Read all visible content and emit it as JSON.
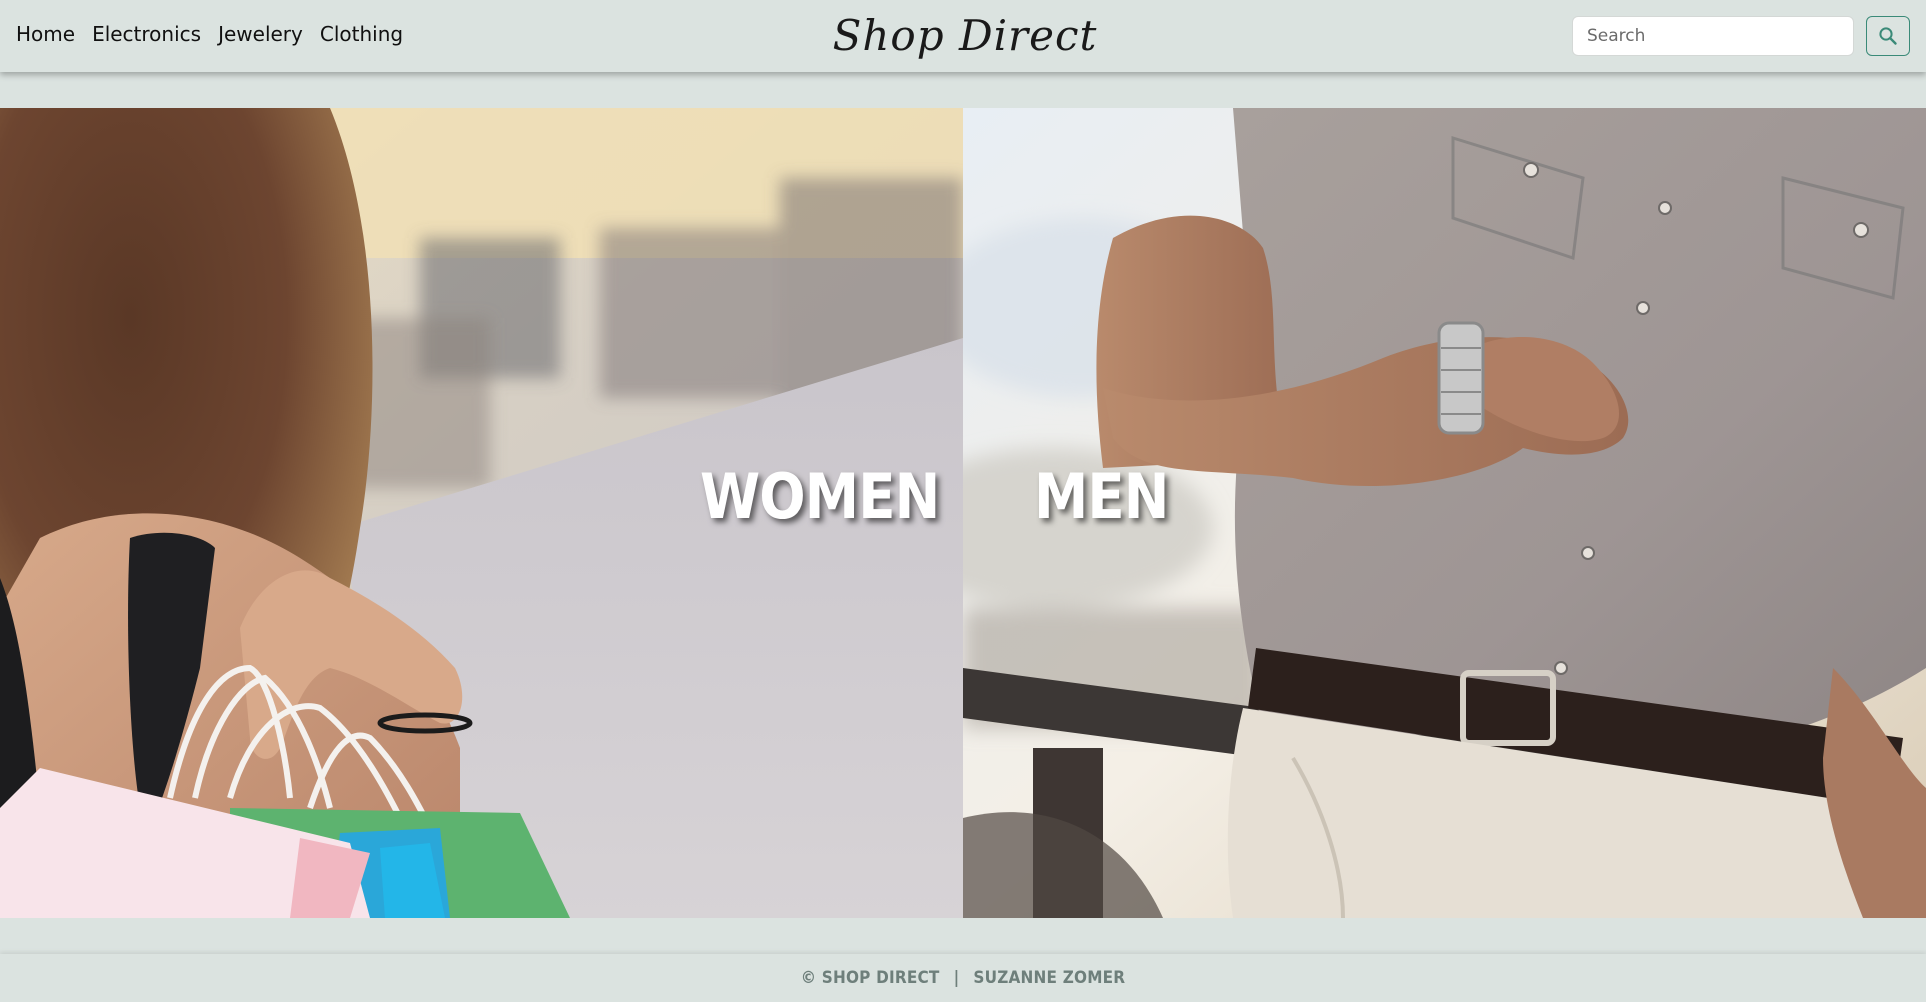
{
  "nav": {
    "links": [
      {
        "label": "Home"
      },
      {
        "label": "Electronics"
      },
      {
        "label": "Jewelery"
      },
      {
        "label": "Clothing"
      }
    ],
    "brand": "Shop Direct",
    "search": {
      "placeholder": "Search",
      "value": ""
    }
  },
  "hero": {
    "women_label": "WOMEN",
    "men_label": "MEN"
  },
  "footer": {
    "copyright": "© SHOP DIRECT",
    "separator": "|",
    "author": "SUZANNE ZOMER"
  },
  "colors": {
    "background": "#dbe3e0",
    "accent": "#3a8a78",
    "footer_text": "#6e7f7b"
  },
  "icons": {
    "search_button": "search-icon"
  }
}
